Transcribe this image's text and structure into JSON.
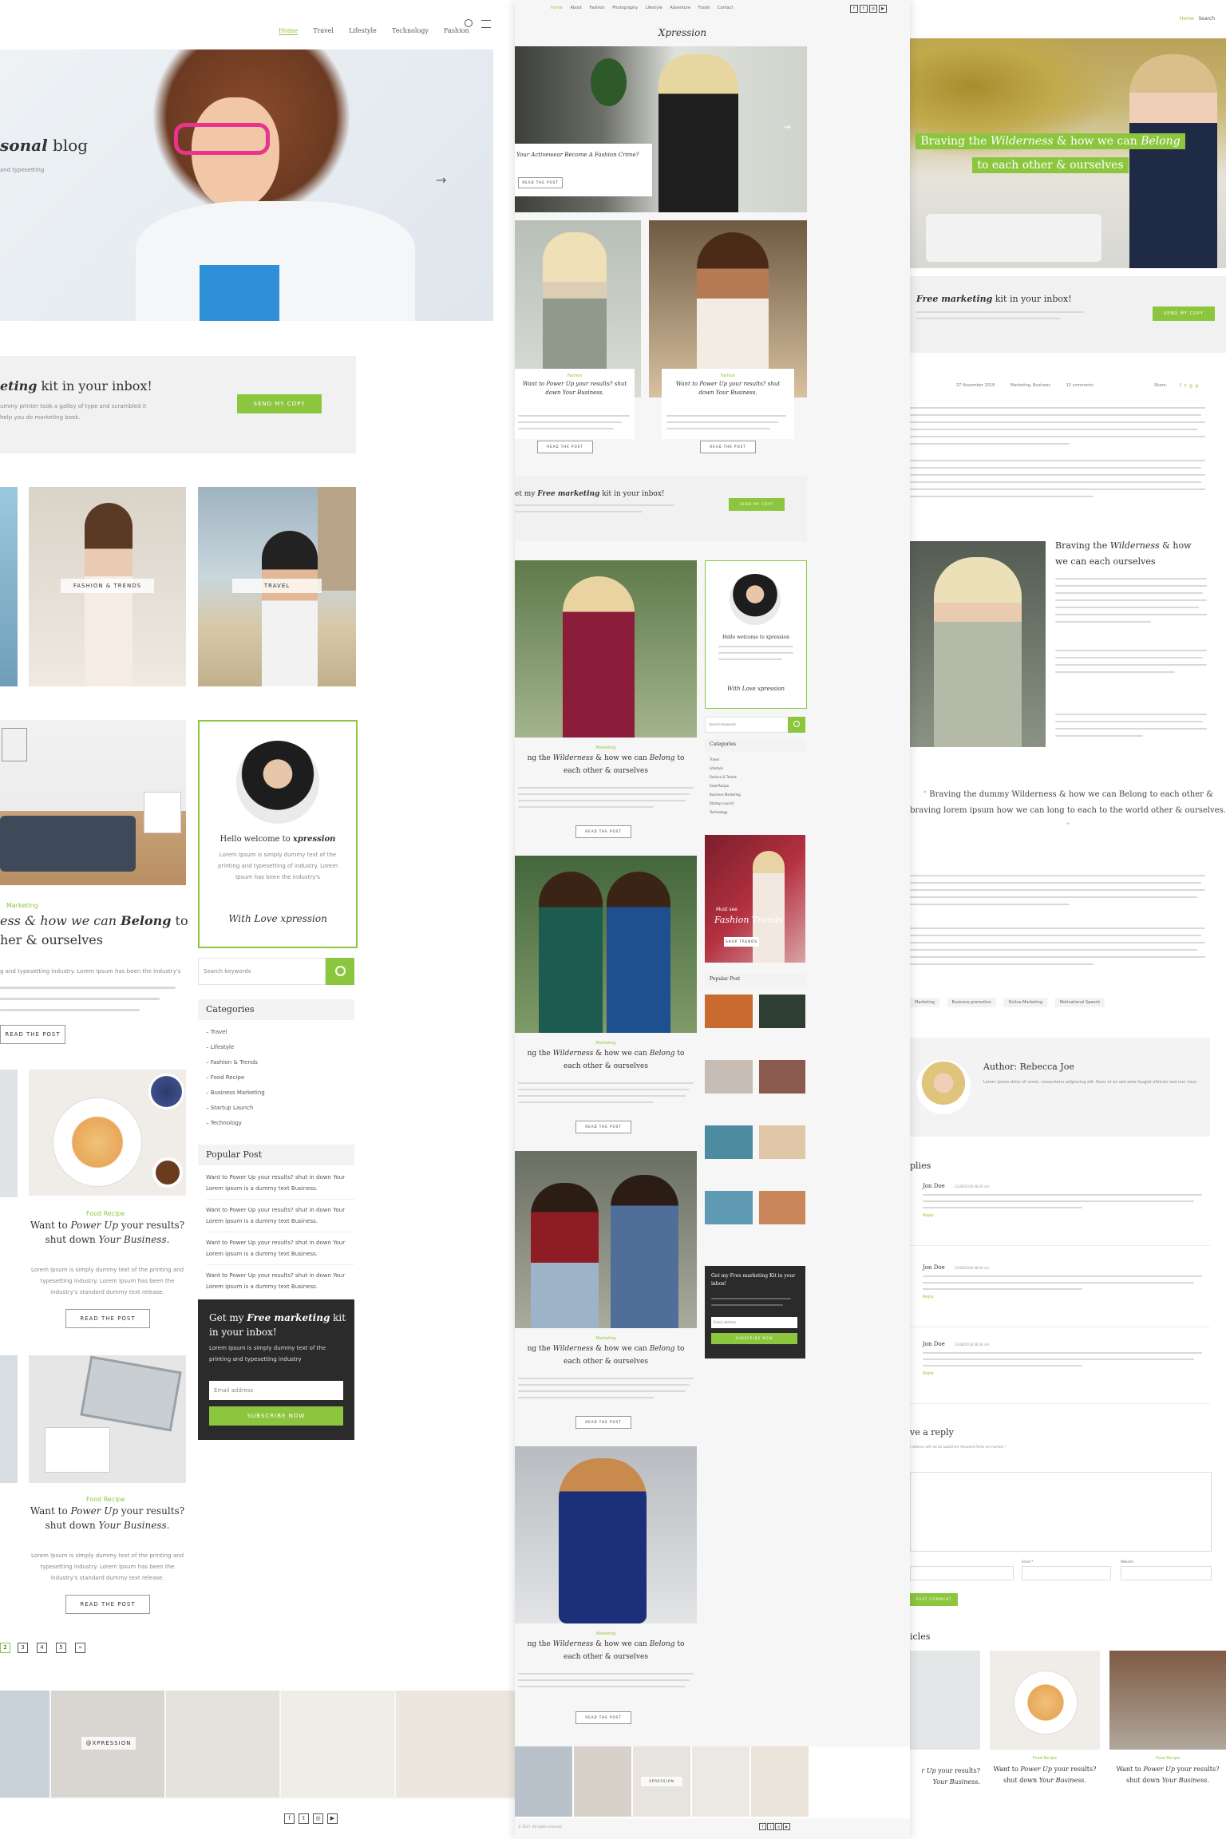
{
  "colA": {
    "nav": [
      "Home",
      "Travel",
      "Lifestyle",
      "Technology",
      "Fashion"
    ],
    "hero_title_a": "sonal",
    "hero_title_b": " blog",
    "hero_sub": "and typesetting",
    "newsletter_title_a": "eting",
    "newsletter_title_b": " kit in your inbox!",
    "newsletter_text": "ummy printer took a galley of type and scrambled it",
    "newsletter_text2": "help you do marketing book.",
    "newsletter_btn": "SEND MY COPY",
    "tag_fashion": "FASHION & TRENDS",
    "tag_travel": "TRAVEL",
    "post1_cat": "Marketing",
    "post1_title_a": "ess & how we can ",
    "post1_title_b": "Belong",
    "post1_title_c": " to",
    "post1_title2": "her & ourselves",
    "post1_text": "g and typesetting industry. Lorem Ipsum has been the industry's",
    "post1_btn": "READ THE POST",
    "welcome_a": "Hello welcome to ",
    "welcome_b": "xpression",
    "welcome_text": "Lorem Ipsum is simply dummy text of the printing and typesetting of industry. Lorem Ipsum has been the industry's",
    "signature": "With Love xpression",
    "search_placeholder": "Search keywords",
    "categories_title": "Categories",
    "categories": [
      "Travel",
      "Lifestyle",
      "Fashion & Trends",
      "Food Recipe",
      "Business Marketing",
      "Startup Launch",
      "Technology"
    ],
    "popular_title": "Popular Post",
    "popular": [
      "Want to Power Up your results? shut in down Your",
      "Lorem ipsum is a dummy text Business.",
      "Want to Power Up your results? shut in down Your",
      "Lorem ipsum is a dummy text Business.",
      "Want to Power Up your results? shut in down Your",
      "Lorem ipsum is a dummy text Business.",
      "Want to Power Up your results? shut in down Your",
      "Lorem ipsum is a dummy text Business."
    ],
    "dark_title_a": "Get my ",
    "dark_title_b": "Free marketing",
    "dark_title_c": " kit",
    "dark_title2": "in your inbox!",
    "dark_text": "Lorem Ipsum is simply dummy text of the printing and typesetting industry",
    "dark_email": "Email address",
    "dark_btn": "SUBSCRIBE NOW",
    "food_cat": "Food Recipe",
    "food_title_a": "Want to ",
    "food_title_b": "Power Up",
    "food_title_c": " your results?",
    "food_title2_a": "shut down ",
    "food_title2_b": "Your Business.",
    "food_text": "Lorem Ipsum is simply dummy text of the printing and typesetting industry. Lorem Ipsum has been the industry's standard dummy text release.",
    "food_btn": "READ THE POST",
    "pagination": [
      "2",
      "3",
      "4",
      "5",
      "»"
    ],
    "insta_tag": "@XPRESSION",
    "social": [
      "f",
      "t",
      "◎",
      "▶"
    ]
  },
  "colB": {
    "nav": [
      "Home",
      "About",
      "Fashion",
      "Photography",
      "Lifestyle",
      "Adventure",
      "Foods",
      "Contact"
    ],
    "logo": "Xpression",
    "slide_title": "Your Activewear Become A Fashion Crime?",
    "slide_btn": "READ THE POST",
    "card_cat": "Fashion",
    "card_title": "Want to Power Up your results? shut down Your Business.",
    "card_btn": "READ THE POST",
    "news_title_a": "et my ",
    "news_title_b": "Free marketing",
    "news_title_c": " kit in your inbox!",
    "news_btn": "SEND MY COPY",
    "welcome": "Hello welcome to xpression",
    "signature": "With Love xpression",
    "search_placeholder": "Search keywords",
    "categories_title": "Categories",
    "categories": [
      "Travel",
      "Lifestyle",
      "Fashion & Trends",
      "Food Recipe",
      "Business Marketing",
      "Startup Launch",
      "Technology"
    ],
    "promo_small": "Must see",
    "promo_big": "Fashion Trends",
    "promo_btn": "SHOP TRENDS",
    "popular_title": "Popular Post",
    "post_cat": "Marketing",
    "post_title_a": "ng the ",
    "post_title_b": "Wilderness",
    "post_title_c": " & how we can ",
    "post_title_d": "Belong",
    "post_title_e": " to",
    "post_title2": "each other & ourselves",
    "post_btn": "READ THE POST",
    "dark_title": "Get my Free marketing Kit in your inbox!",
    "dark_email": "Email address",
    "dark_btn": "SUBSCRIBE NOW",
    "footer": "XPRESSION",
    "copyright": "© 2017. All rights reserved."
  },
  "colC": {
    "nav": [
      "Home",
      "Search"
    ],
    "hero_a": "Braving the ",
    "hero_b": "Wilderness",
    "hero_c": " & how we can ",
    "hero_d": "Belong",
    "hero_line2": "to each other & ourselves",
    "news_title_a": "Free marketing",
    "news_title_b": " kit in your inbox!",
    "news_btn": "SEND MY COPY",
    "meta_date": "27 November 2018",
    "meta_cat": "Marketing, Business",
    "meta_comments": "12 comments",
    "share": "Share:",
    "inline_title_a": "Braving the ",
    "inline_title_b": "Wilderness",
    "inline_title_c": " & how",
    "inline_title2": "we can each ourselves",
    "quote": "Braving the dummy Wilderness & how we can Belong to each other & braving lorem ipsum how we can long to each to the world other & ourselves.",
    "tags": [
      "Marketing",
      "Business promotion",
      "Online Marketing",
      "Motivational Speech"
    ],
    "author": "Author: Rebecca Joe",
    "author_text": "Lorem ipsum dolor sit amet, consectetur adipiscing elit. Nunc et ex sed ante feugiat ultricies sed non risus.",
    "replies_title": "plies",
    "commenters": [
      "Jon Doe",
      "Jon Doe",
      "Jon Doe"
    ],
    "comment_date": "22/08/2018 08:30 am",
    "reply": "Reply",
    "leave_reply": "ve a reply",
    "leave_note": "l address will not be published. Required fields are marked *",
    "email_label": "Email *",
    "website_label": "Website",
    "post_btn": "POST COMMENT",
    "related_title": "icles",
    "rel_cat": "Food Recipe",
    "rel_title_a": "Want to ",
    "rel_title_b": "Power Up",
    "rel_title_c": " your results?",
    "rel_title2_a": "shut down ",
    "rel_title2_b": "Your Business.",
    "rel_left_a": "r Up",
    "rel_left_b": " your results?",
    "rel_left2": "Your Business."
  }
}
